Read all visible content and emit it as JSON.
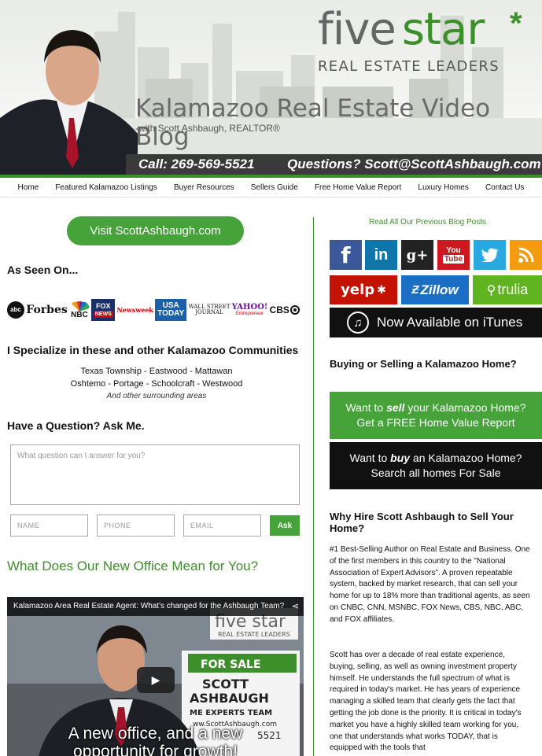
{
  "header": {
    "logo_five": "five",
    "logo_star": "star",
    "logo_asterisk": "*",
    "logo_sub": "REAL ESTATE LEADERS",
    "title": "Kalamazoo Real Estate Video Blog",
    "subtitle": "-with Scott Ashbaugh, REALTOR®",
    "call": "Call:  269-569-5521",
    "questions": "Questions? Scott@ScottAshbaugh.com"
  },
  "nav": [
    "Home",
    "Featured Kalamazoo Listings",
    "Buyer Resources",
    "Sellers Guide",
    "Free Home Value Report",
    "Luxury Homes",
    "Contact Us"
  ],
  "left": {
    "visit_button": "Visit ScottAshbaugh.com",
    "as_seen_on": "As Seen On...",
    "media_logos": {
      "abc": "abc",
      "forbes": "Forbes",
      "nbc": "NBC",
      "fox_top": "FOX",
      "fox_bottom": "NEWS",
      "newsweek": "Newsweek",
      "usa_top": "USA",
      "usa_bottom": "TODAY",
      "wsj_top": "WALL STREET",
      "wsj_bottom": "JOURNAL",
      "yahoo_top": "YAHOO!",
      "yahoo_bottom": "Entrepreneur",
      "cbs": "CBS"
    },
    "specialize_heading": "I Specialize in these and other Kalamazoo Communities",
    "communities_line1": "Texas Township - Eastwood - Mattawan",
    "communities_line2": "Oshtemo - Portage - Schoolcraft - Westwood",
    "communities_line3": "And other surrounding areas",
    "ask_heading": "Have a Question? Ask Me.",
    "ask_placeholder": "What question can I answer for you?",
    "name_placeholder": "NAME",
    "phone_placeholder": "PHONE",
    "email_placeholder": "EMAIL",
    "ask_button": "Ask",
    "office_heading": "What Does Our New Office Mean for You?",
    "video": {
      "title": "Kalamazoo Area Real Estate Agent: What's changed for the Ashbaugh Team?",
      "caption_line1": "A new office, and a new",
      "caption_line2": "opportunity for growth!",
      "sign_logo": "five star",
      "sign_logo_sub": "REAL ESTATE LEADERS",
      "sign_for_sale": "FOR SALE",
      "sign_line1": "SCOTT",
      "sign_line2": "ASHBAUGH",
      "sign_line3": "ME EXPERTS TEAM",
      "sign_url": "ww.ScottAshbaugh.com",
      "sign_phone": "5521"
    }
  },
  "right": {
    "read_all": "Read All Our Previous Blog Posts",
    "social": {
      "facebook": "f",
      "linkedin": "in",
      "googleplus": "g+",
      "youtube_top": "You",
      "youtube_bottom": "Tube",
      "twitter": "🐦",
      "rss": "⌁",
      "yelp": "yelp",
      "zillow": "Zillow",
      "trulia": "trulia"
    },
    "itunes": "Now Available on iTunes",
    "buying_heading": "Buying or Selling a Kalamazoo Home?",
    "sell_cta_pre": "Want to ",
    "sell_cta_em": "sell",
    "sell_cta_post": " your Kalamazoo Home?",
    "sell_cta_line2": "Get a FREE Home Value Report",
    "buy_cta_pre": "Want to ",
    "buy_cta_em": "buy",
    "buy_cta_post": " an Kalamazoo Home?",
    "buy_cta_line2": "Search all homes For Sale",
    "why_heading": "Why Hire Scott Ashbaugh to Sell Your Home?",
    "para1": "#1 Best-Selling Author on Real Estate and Business. One of the first members in this country to the \"National Association of Expert Advisors\". A proven repeatable system, backed by market research, that can sell your home for up to 18% more than traditional agents, as seen on CNBC, CNN, MSNBC, FOX News, CBS, NBC, ABC, and FOX affiliates.",
    "para2": "Scott has over a decade of real estate experience, buying, selling, as well as owning investment property himself. He understands the full spectrum of what is required in today's market. He has years of experience managing a skilled team that clearly gets the fact that getting the job done is the priority. It is critical in today's market you have a highly skilled team working for you, one that understands what works TODAY, that is equipped with the tools that"
  },
  "colors": {
    "brand_green": "#3d8f2b",
    "button_green": "#45a33a",
    "dark_bar": "#3a3a3a",
    "facebook": "#3b5998",
    "linkedin": "#0e76a8",
    "googleplus": "#222222",
    "youtube": "#cc181e",
    "twitter": "#2aa9e0",
    "rss": "#f39c12",
    "yelp": "#c41200",
    "zillow": "#1a6fc4",
    "trulia": "#5fb41f"
  }
}
